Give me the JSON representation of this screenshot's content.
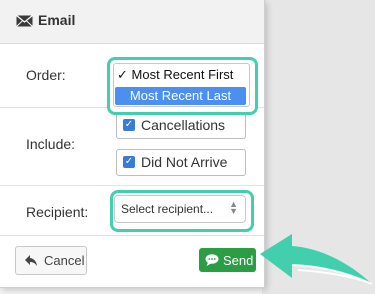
{
  "dialog": {
    "title": "Email",
    "order_label": "Order:",
    "include_label": "Include:",
    "recipient_label": "Recipient:"
  },
  "order": {
    "options": [
      "Most Recent First",
      "Most Recent Last"
    ],
    "checked_mark": "✓",
    "highlighted_index": 1
  },
  "include": {
    "items": [
      {
        "label": "Cancellations",
        "checked": true
      },
      {
        "label": "Did Not Arrive",
        "checked": true
      }
    ]
  },
  "recipient": {
    "placeholder": "Select recipient..."
  },
  "buttons": {
    "cancel": "Cancel",
    "send": "Send"
  },
  "colors": {
    "highlight_ring": "#41cfae",
    "selected_option": "#4b8ff0",
    "send_button": "#2a9d45",
    "checkbox": "#3a7bd5"
  },
  "icons": {
    "title": "envelope-icon",
    "cancel": "reply-arrow-icon",
    "send": "speech-bubble-icon",
    "callout": "pointer-arrow-icon"
  }
}
